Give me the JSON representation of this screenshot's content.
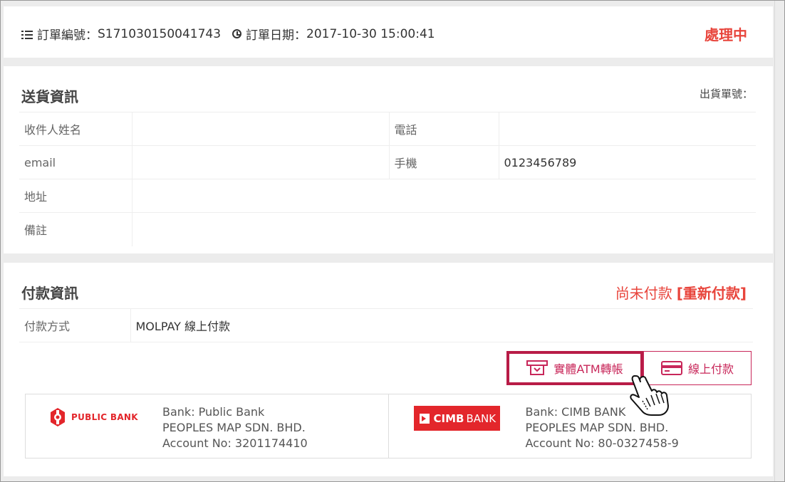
{
  "order": {
    "number_label": "訂單編號：",
    "number": "S171030150041743",
    "date_label": "訂單日期：",
    "date": "2017-10-30 15:00:41",
    "status": "處理中"
  },
  "shipping": {
    "title": "送貨資訊",
    "ship_no_label": "出貨單號：",
    "recipient_label": "收件人姓名",
    "recipient_value": "",
    "phone_label": "電話",
    "phone_value": "",
    "email_label": "email",
    "email_value": "",
    "mobile_label": "手機",
    "mobile_value": "0123456789",
    "address_label": "地址",
    "address_value": "",
    "note_label": "備註",
    "note_value": ""
  },
  "payment": {
    "title": "付款資訊",
    "status": "尚未付款",
    "repay_link": "[重新付款]",
    "method_label": "付款方式",
    "method_value": "MOLPAY 線上付款",
    "tabs": {
      "atm": "實體ATM轉帳",
      "online": "線上付款"
    },
    "banks": [
      {
        "logo_text": "PUBLIC BANK",
        "bank": "Bank: Public Bank",
        "holder": "PEOPLES MAP SDN. BHD.",
        "account": "Account No: 3201174410"
      },
      {
        "logo_text": "CIMB",
        "logo_text_2": "BANK",
        "bank": "Bank: CIMB BANK",
        "holder": "PEOPLES MAP SDN. BHD.",
        "account": "Account No: 80-0327458-9"
      }
    ]
  },
  "colors": {
    "status_red": "#e8453c",
    "accent_crimson": "#b81c47",
    "bank_red": "#e3262b"
  },
  "icons": [
    "list-icon",
    "clock-icon",
    "atm-icon",
    "credit-card-icon",
    "hand-pointer-icon"
  ]
}
